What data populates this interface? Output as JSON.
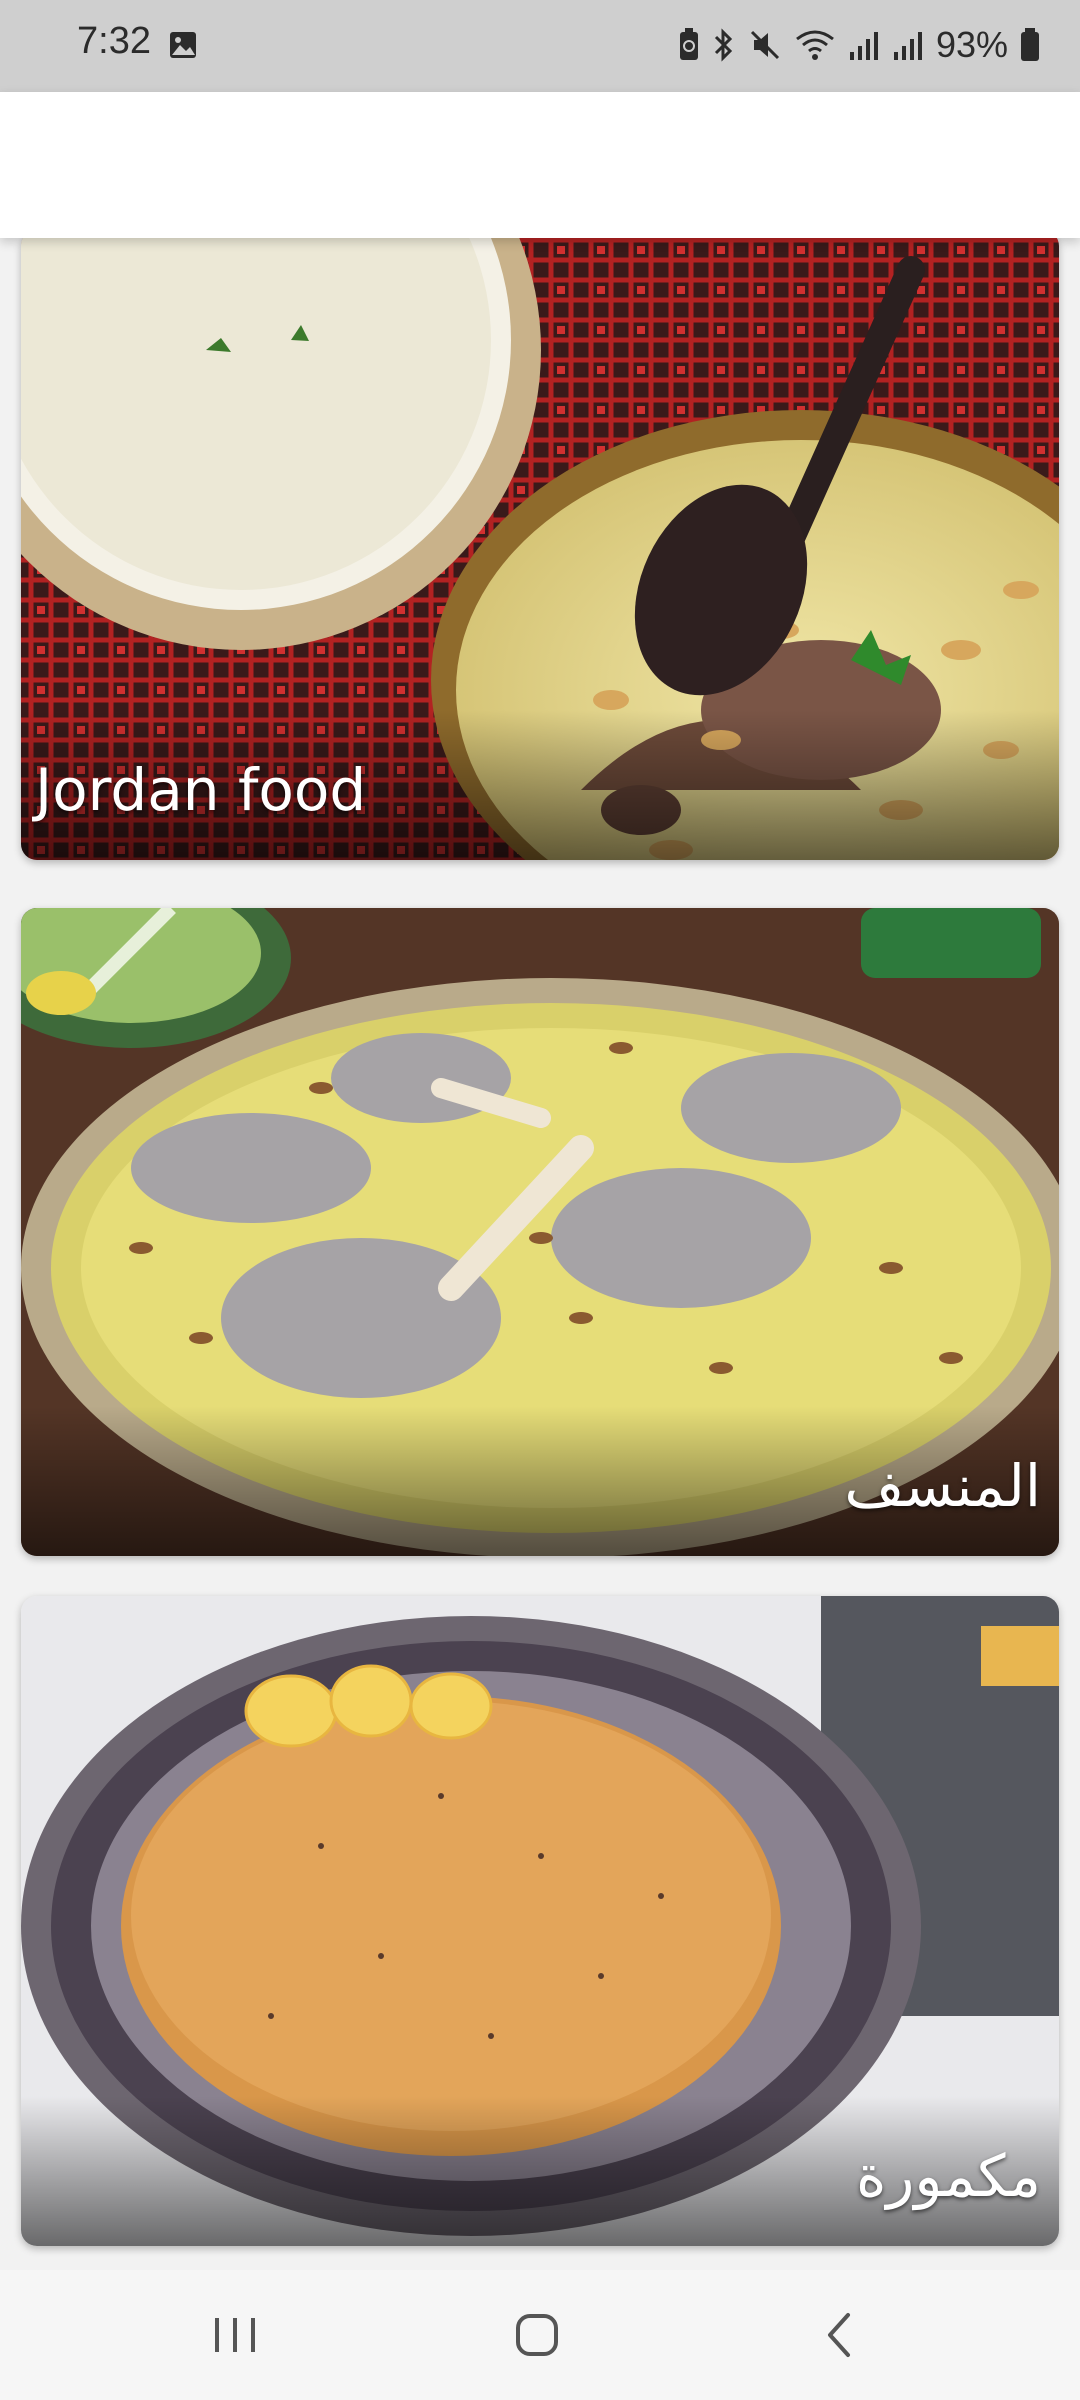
{
  "status_bar": {
    "time": "7:32",
    "battery": "93%",
    "icons": [
      "image-icon",
      "recycle-battery-icon",
      "bluetooth-icon",
      "mute-icon",
      "wifi-icon",
      "signal-icon",
      "signal-2-icon",
      "battery-icon"
    ]
  },
  "colors": {
    "status_bg": "#cfcfcf",
    "app_bar_bg": "#ffffff",
    "page_bg": "#f2f2f2",
    "card_title": "#ffffff"
  },
  "cards": [
    {
      "title": "Jordan food"
    },
    {
      "title": "المنسف"
    },
    {
      "title": "مكمورة"
    }
  ],
  "nav_bar": {
    "icons": [
      "recents-icon",
      "home-icon",
      "back-icon"
    ]
  }
}
